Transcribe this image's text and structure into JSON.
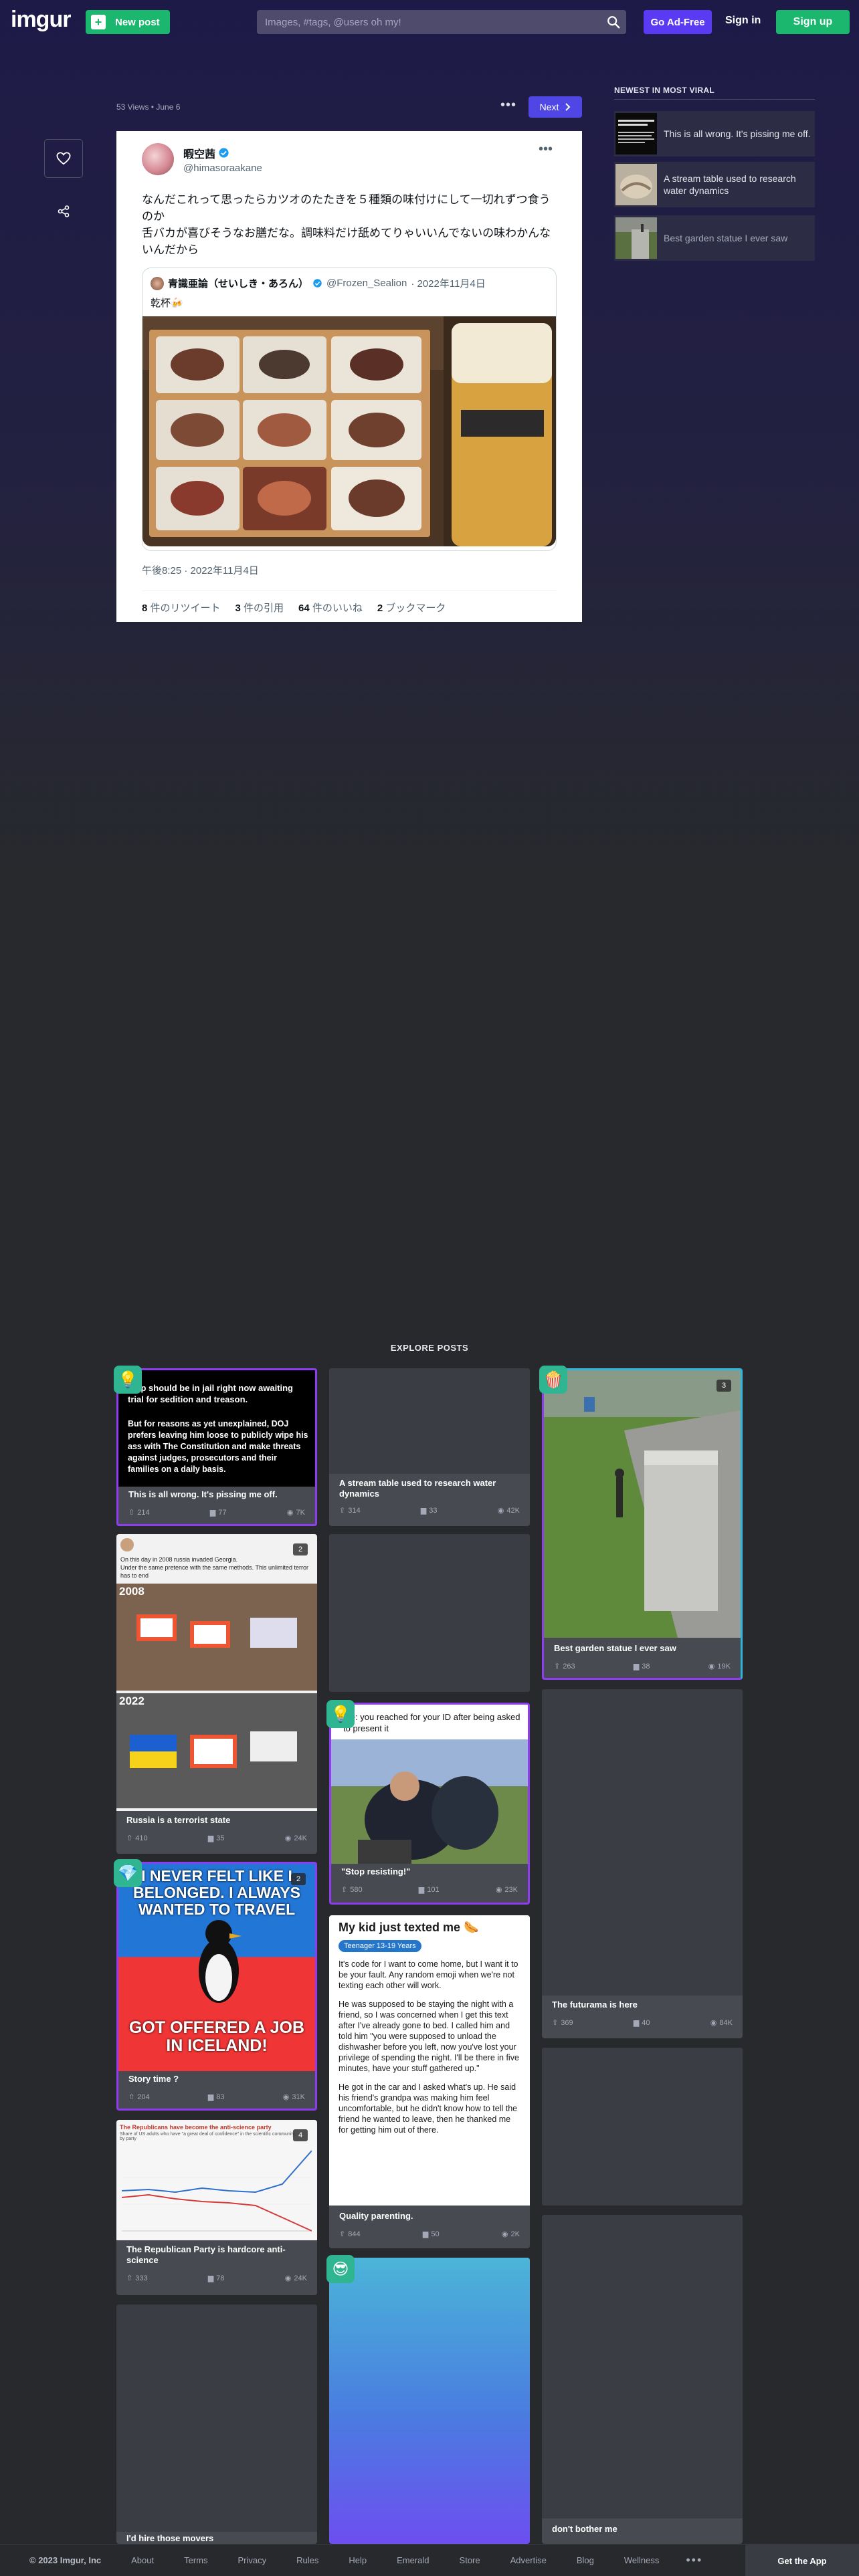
{
  "header": {
    "logo": "imgur",
    "new_post": "New post",
    "search_placeholder": "Images, #tags, @users oh my!",
    "go_adfree": "Go Ad-Free",
    "sign_in": "Sign in",
    "sign_up": "Sign up"
  },
  "post": {
    "meta": "53 Views • June 6",
    "next": "Next"
  },
  "tweet": {
    "display_name": "暇空茜",
    "handle": "@himasoraakane",
    "text_lines": [
      "なんだこれって思ったらカツオのたたきを５種類の味付けにして一切れずつ食うのか",
      "舌バカが喜びそうなお膳だな。調味料だけ舐めてりゃいいんでないの味わかんないんだから"
    ],
    "quote": {
      "name": "青識亜論（せいしき・あろん）",
      "handle": "@Frozen_Sealion",
      "date": "· 2022年11月4日",
      "text": "乾杯🍻"
    },
    "timestamp": "午後8:25 · 2022年11月4日",
    "stats": [
      {
        "num": "8",
        "label": " 件のリツイート"
      },
      {
        "num": "3",
        "label": " 件の引用"
      },
      {
        "num": "64",
        "label": " 件のいいね"
      },
      {
        "num": "2",
        "label": " ブックマーク"
      }
    ]
  },
  "newest": {
    "title": "NEWEST IN MOST VIRAL",
    "items": [
      {
        "title": "This is all wrong.  It's pissing me off."
      },
      {
        "title": "A stream table used to research water dynamics"
      },
      {
        "title": "Best garden statue I ever saw"
      }
    ]
  },
  "explore": {
    "title": "EXPLORE POSTS",
    "cards": {
      "c1": {
        "title": "This is all wrong.  It's pissing me off.",
        "up": "214",
        "cm": "77",
        "vw": "7K",
        "img_text_1": "ump should be in jail right now awaiting trial for sedition and treason.",
        "img_text_2": "But for reasons as yet unexplained, DOJ prefers leaving him loose to publicly wipe his ass with The Constitution and make threats against judges, prosecutors and their families on a daily basis."
      },
      "c2": {
        "title": "A stream table used to research water dynamics",
        "up": "314",
        "cm": "33",
        "vw": "42K"
      },
      "c3": {
        "title": "Best garden statue I ever saw",
        "up": "263",
        "cm": "38",
        "vw": "19K",
        "count": "3"
      },
      "c4": {
        "title": "Russia is a terrorist state",
        "up": "410",
        "cm": "35",
        "vw": "24K",
        "count": "2",
        "y1": "2008",
        "y2": "2022",
        "line1": "On this day in 2008 russia invaded Georgia.",
        "line2": "Under the same pretence with the same methods. This unlimited terror has to end"
      },
      "c5": {
        "title": "\"Stop resisting!\"",
        "up": "580",
        "cm": "101",
        "vw": "23K",
        "img_text": "Me: you reached for your ID after being asked to present it"
      },
      "c6": {
        "title": "The futurama is here",
        "up": "369",
        "cm": "40",
        "vw": "84K"
      },
      "c7": {
        "title": "Story time ?",
        "up": "204",
        "cm": "83",
        "vw": "31K",
        "count": "2",
        "top_text": "I NEVER FELT LIKE I BELONGED. I ALWAYS WANTED TO TRAVEL",
        "bottom_text": "GOT OFFERED A JOB IN ICELAND!"
      },
      "c8": {
        "title": "Quality parenting.",
        "up": "844",
        "cm": "50",
        "vw": "2K",
        "heading": "My kid just texted me 🌭",
        "tag": "Teenager 13-19 Years",
        "p1": "It's code for I want to come home, but I want it to be your fault. Any random emoji when we're not texting each other will work.",
        "p2": "He was supposed to be staying the night with a friend, so I was concerned when I get this text after I've already gone to bed. I called him and told him \"you were supposed to unload the dishwasher before you left, now you've lost your privilege of spending the night. I'll be there in five minutes, have your stuff gathered up.\"",
        "p3": "He got in the car and I asked what's up. He said his friend's grandpa was making him feel uncomfortable, but he didn't know how to tell the friend he wanted to leave, then he thanked me for getting him out of there."
      },
      "c9": {
        "title": "The Republican Party is hardcore anti-science",
        "up": "333",
        "cm": "78",
        "vw": "24K",
        "count": "4",
        "chart_title": "The Republicans have become the anti-science party",
        "chart_sub": "Share of US adults who have \"a great deal of confidence\" in the scientific community, by party"
      },
      "c10": {
        "title": "I'd hire those movers"
      },
      "c11": {
        "title": "don't bother me"
      }
    }
  },
  "footer": {
    "copy": "© 2023 Imgur, Inc",
    "links": [
      "About",
      "Terms",
      "Privacy",
      "Rules",
      "Help",
      "Emerald",
      "Store",
      "Advertise",
      "Blog",
      "Wellness"
    ],
    "get_app": "Get the App"
  },
  "colors": {
    "accent_green": "#1bb76e",
    "accent_purple": "#5a3af2",
    "next_blue": "#4f46e5",
    "promo_purple": "#8e3df0",
    "promo_cyan": "#2fb5d9"
  }
}
